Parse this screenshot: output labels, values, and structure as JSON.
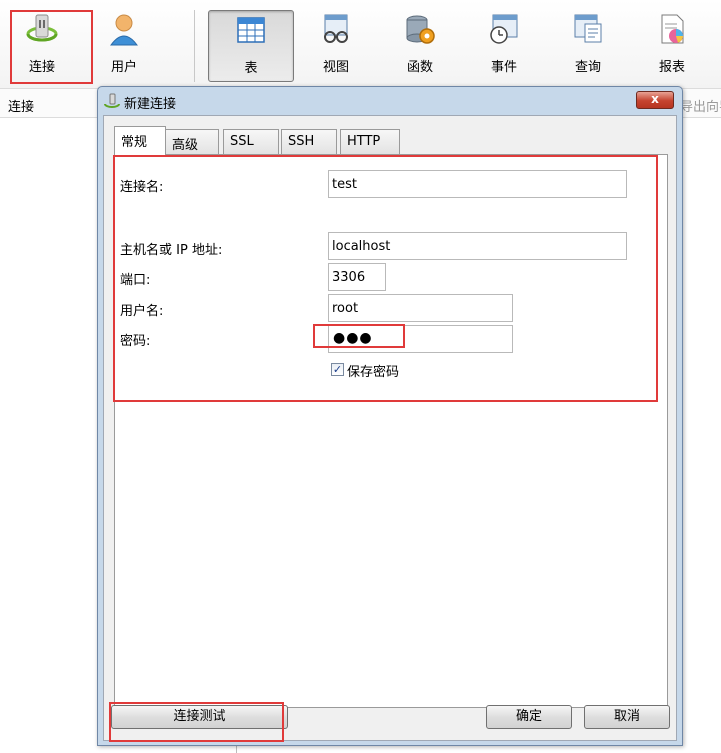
{
  "toolbar": {
    "items": [
      {
        "label": "连接",
        "icon": "plug-connect-icon"
      },
      {
        "label": "用户",
        "icon": "user-icon"
      },
      {
        "label": "表",
        "icon": "table-icon"
      },
      {
        "label": "视图",
        "icon": "view-glasses-icon"
      },
      {
        "label": "函数",
        "icon": "function-gear-icon"
      },
      {
        "label": "事件",
        "icon": "event-clock-icon"
      },
      {
        "label": "查询",
        "icon": "query-icon"
      },
      {
        "label": "报表",
        "icon": "report-icon"
      }
    ]
  },
  "subbar": {
    "left_label": "连接",
    "right_partial": "导出向导"
  },
  "dialog": {
    "title": "新建连接",
    "close_label": "x",
    "tabs": [
      "常规",
      "高级",
      "SSL",
      "SSH",
      "HTTP"
    ],
    "fields": {
      "connection_name_label": "连接名:",
      "connection_name_value": "test",
      "host_label": "主机名或 IP 地址:",
      "host_value": "localhost",
      "port_label": "端口:",
      "port_value": "3306",
      "username_label": "用户名:",
      "username_value": "root",
      "password_label": "密码:",
      "password_dots": "●●●",
      "save_password_label": "保存密码",
      "save_password_checked": "✓"
    },
    "buttons": {
      "test": "连接测试",
      "ok": "确定",
      "cancel": "取消"
    }
  },
  "colors": {
    "highlight": "#e03a3a",
    "dialog_frame": "#c6d8ea",
    "close_button": "#c5432f"
  }
}
